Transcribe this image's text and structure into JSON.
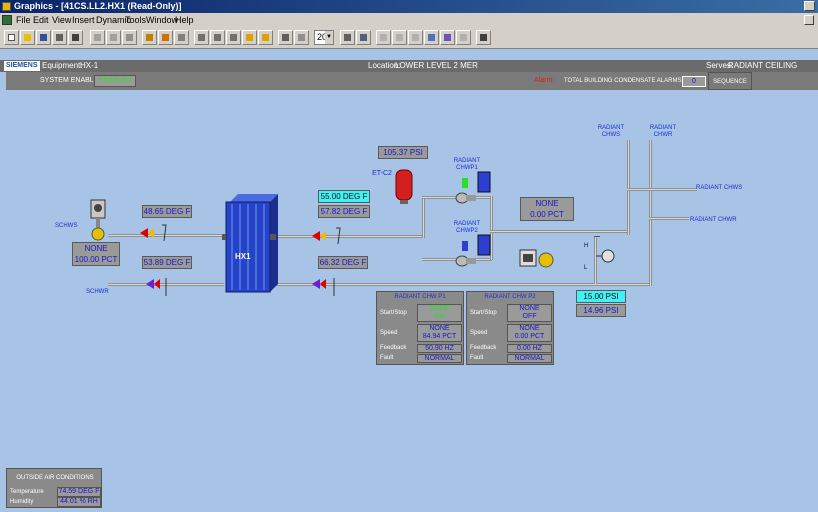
{
  "window": {
    "title": "Graphics - [41CS.LL2.HX1 (Read-Only)]"
  },
  "menu": [
    "File",
    "Edit",
    "View",
    "Insert",
    "Dynamic",
    "Tools",
    "Window",
    "Help"
  ],
  "toolbar": {
    "zoom_value": "20"
  },
  "header": {
    "brand": "SIEMENS",
    "equipment_label": "Equipment:",
    "equipment_value": "HX-1",
    "location_label": "Location:",
    "location_value": "LOWER LEVEL 2 MER",
    "serves_label": "Serves:",
    "serves_value": "RADIANT CEILING PANELS",
    "system_enable_label": "SYSTEM ENABLE",
    "system_enable_value": "ENABLED",
    "alarm_label": "Alarm:",
    "alarm_text": "TOTAL BUILDING CONDENSATE ALARMS",
    "alarm_value": "0",
    "sequence_label": "SEQUENCE"
  },
  "diagram": {
    "hx_label": "HX1",
    "schws_label": "SCHWS",
    "schwr_label": "SCHWR",
    "valve_cmd_line1": "NONE",
    "valve_cmd_line2": "100.00 PCT",
    "schws_temp": "48.65 DEG F",
    "schwr_temp": "53.89 DEG F",
    "supply_setpoint": "55.00 DEG F",
    "supply_temp": "57.82 DEG F",
    "return_temp": "66.32 DEG F",
    "pressure_top": "105.37 PSI",
    "et_label": "ET-C2",
    "pump1_label_1": "RADIANT",
    "pump1_label_2": "CHWP1",
    "pump2_label_1": "RADIANT",
    "pump2_label_2": "CHWP2",
    "bypass_line1": "NONE",
    "bypass_line2": "0.00 PCT",
    "radiant_chws_top_1": "RADIANT",
    "radiant_chws_top_2": "CHWS",
    "radiant_chwr_top_1": "RADIANT",
    "radiant_chwr_top_2": "CHWR",
    "radiant_chws_right": "RADIANT CHWS",
    "radiant_chwr_right": "RADIANT CHWR",
    "dp_h": "H",
    "dp_l": "L",
    "dp_setpoint": "15.00 PSI",
    "dp_value": "14.96 PSI"
  },
  "pumps": [
    {
      "title": "RADIANT CHW P1",
      "start_stop_label": "Start/Stop",
      "start_stop_line1": "NONE",
      "start_stop_line2": "ON",
      "speed_label": "Speed",
      "speed_line1": "NONE",
      "speed_line2": "84.94 PCT",
      "feedback_label": "Feedback",
      "feedback_value": "50.90 HZ",
      "fault_label": "Fault",
      "fault_value": "NORMAL"
    },
    {
      "title": "RADIANT CHW P2",
      "start_stop_label": "Start/Stop",
      "start_stop_line1": "NONE",
      "start_stop_line2": "OFF",
      "speed_label": "Speed",
      "speed_line1": "NONE",
      "speed_line2": "0.00 PCT",
      "feedback_label": "Feedback",
      "feedback_value": "0.00 HZ",
      "fault_label": "Fault",
      "fault_value": "NORMAL"
    }
  ],
  "outside_air": {
    "title": "OUTSIDE AIR CONDITIONS",
    "temp_label": "Temperature",
    "temp_value": "74.59 DEG F",
    "humidity_label": "Humidity",
    "humidity_value": "44.01 % RH"
  },
  "colors": {
    "background": "#a7c3e6",
    "hx_blue": "#2344c8",
    "setpoint_cyan": "#43f0f4",
    "value_blue": "#1717c9",
    "alarm_red": "#d21f1f",
    "enabled_green": "#29e029"
  }
}
